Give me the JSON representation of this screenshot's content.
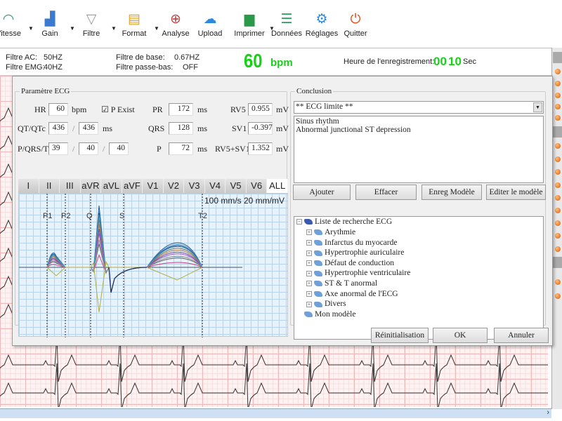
{
  "toolbar": {
    "items": [
      {
        "label": "Vitesse",
        "icon": "gauge-icon",
        "color": "#2a9a6a",
        "glyph": "◠",
        "dropdown": true
      },
      {
        "label": "Gain",
        "icon": "signal-bars-icon",
        "color": "#3a7ad0",
        "glyph": "▟",
        "dropdown": true
      },
      {
        "label": "Filtre",
        "icon": "filter-icon",
        "color": "#999999",
        "glyph": "▽",
        "dropdown": true
      },
      {
        "label": "Format",
        "icon": "format-icon",
        "color": "#e0a020",
        "glyph": "▤",
        "dropdown": true
      },
      {
        "label": "Analyse",
        "icon": "analyse-icon",
        "color": "#c04040",
        "glyph": "⊕",
        "dropdown": false
      },
      {
        "label": "Upload",
        "icon": "cloud-upload-icon",
        "color": "#2a8ae0",
        "glyph": "☁",
        "dropdown": false
      },
      {
        "label": "Imprimer",
        "icon": "printer-icon",
        "color": "#2a9a4a",
        "glyph": "▆",
        "dropdown": true
      },
      {
        "label": "Données",
        "icon": "database-icon",
        "color": "#3aa06a",
        "glyph": "☰",
        "dropdown": false
      },
      {
        "label": "Réglages",
        "icon": "gear-icon",
        "color": "#2a8ae0",
        "glyph": "⚙",
        "dropdown": false
      },
      {
        "label": "Quitter",
        "icon": "power-icon",
        "color": "#e05020",
        "glyph": "⏻",
        "dropdown": false
      }
    ]
  },
  "info": {
    "ac_label": "Filtre AC:",
    "ac_value": "50HZ",
    "emg_label": "Filtre EMG:",
    "emg_value": "40HZ",
    "base_label": "Filtre de base:",
    "base_value": "0.67HZ",
    "lowpass_label": "Filtre passe-bas:",
    "lowpass_value": "OFF",
    "hr_value": "60",
    "hr_unit": "bpm",
    "rec_label": "Heure de l'enregistrement:",
    "rec_min": "00",
    "rec_sec": "10",
    "rec_unit": "Sec"
  },
  "params": {
    "title": "Paramètre ECG",
    "hr_label": "HR",
    "hr": "60",
    "bpm": "bpm",
    "p_exist": "P Exist",
    "p_exist_checked": true,
    "qt_label": "QT/QTc",
    "qt": "436",
    "qtc": "436",
    "ms": "ms",
    "pqrst_label": "P/QRS/T",
    "p_axis": "39",
    "qrs_axis": "40",
    "t_axis": "40",
    "pr_label": "PR",
    "pr": "172",
    "qrs_label": "QRS",
    "qrs": "128",
    "p_label": "P",
    "p": "72",
    "rv5_label": "RV5",
    "rv5": "0.955",
    "sv1_label": "SV1",
    "sv1": "-0.397",
    "sum_label": "RV5+SV1",
    "sum": "1.352",
    "mv": "mV",
    "slash": "/"
  },
  "leads": [
    "I",
    "II",
    "III",
    "aVR",
    "aVL",
    "aVF",
    "V1",
    "V2",
    "V3",
    "V4",
    "V5",
    "V6",
    "ALL"
  ],
  "active_lead": "ALL",
  "plot": {
    "scale": "100 mm/s 20 mm/mV",
    "markers": [
      "P1",
      "P2",
      "Q",
      "S",
      "T2"
    ]
  },
  "conclusion": {
    "title": "Conclusion",
    "selected": "** ECG limite **",
    "text_lines": [
      "Sinus rhythm",
      "Abnormal junctional ST depression"
    ],
    "buttons": [
      "Ajouter",
      "Effacer",
      "Enreg Modèle",
      "Editer le modèle"
    ],
    "tree_root": "Liste de recherche ECG",
    "tree_items": [
      "Arythmie",
      "Infarctus du myocarde",
      "Hypertrophie auriculaire",
      "Défaut de conduction",
      "Hypertrophie ventriculaire",
      "ST & T anormal",
      "Axe anormal de l'ECG",
      "Divers"
    ],
    "tree_mine": "Mon modèle"
  },
  "footer": {
    "reset": "Réinitialisation",
    "ok": "OK",
    "cancel": "Annuler"
  }
}
